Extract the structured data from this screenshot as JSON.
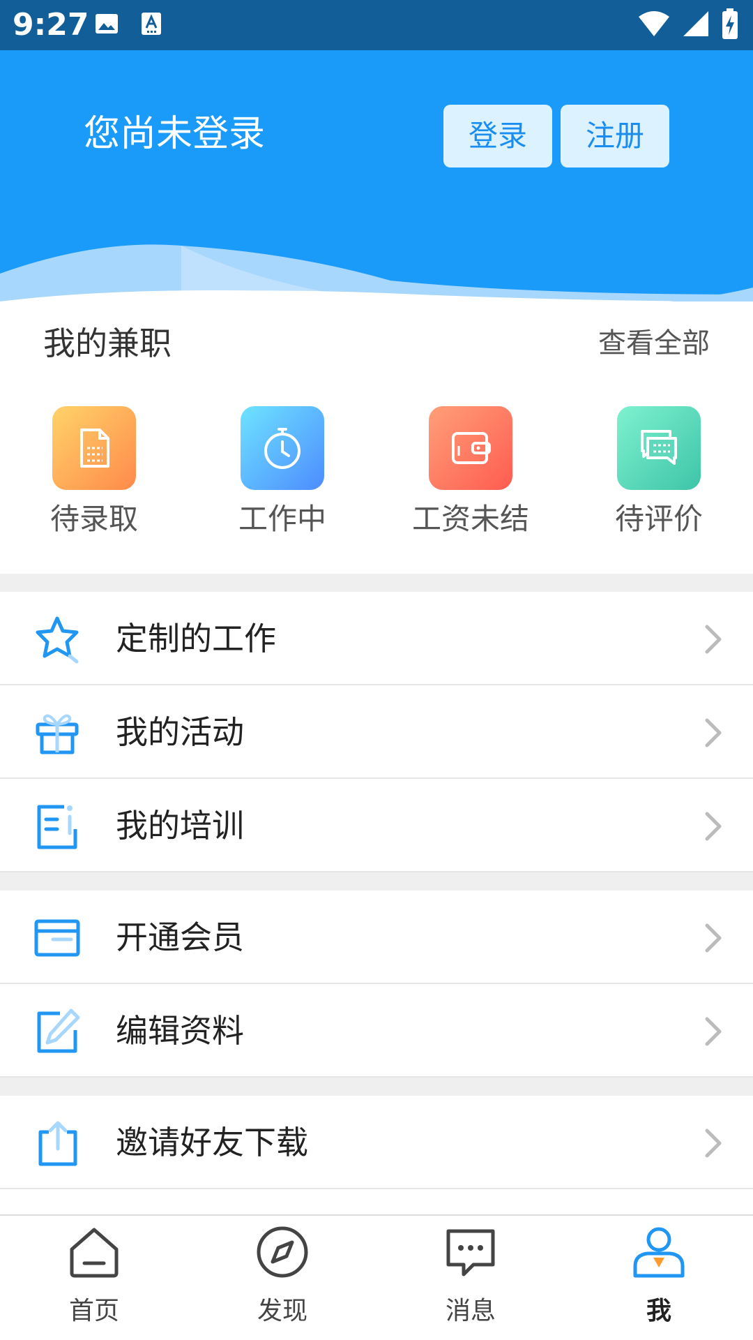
{
  "status_bar": {
    "time": "9:27"
  },
  "header": {
    "title": "您尚未登录",
    "login_label": "登录",
    "register_label": "注册"
  },
  "part_time": {
    "title": "我的兼职",
    "view_all": "查看全部",
    "items": [
      {
        "label": "待录取",
        "icon": "document-icon"
      },
      {
        "label": "工作中",
        "icon": "stopwatch-icon"
      },
      {
        "label": "工资未结",
        "icon": "wallet-icon"
      },
      {
        "label": "待评价",
        "icon": "chat-bubbles-icon"
      }
    ]
  },
  "menu": {
    "group1": [
      {
        "label": "定制的工作",
        "icon": "star-icon"
      },
      {
        "label": "我的活动",
        "icon": "gift-icon"
      },
      {
        "label": "我的培训",
        "icon": "training-icon"
      }
    ],
    "group2": [
      {
        "label": "开通会员",
        "icon": "card-icon"
      },
      {
        "label": "编辑资料",
        "icon": "edit-icon"
      }
    ],
    "group3": [
      {
        "label": "邀请好友下载",
        "icon": "share-icon"
      }
    ]
  },
  "bottom_nav": {
    "items": [
      {
        "label": "首页",
        "icon": "home-icon"
      },
      {
        "label": "发现",
        "icon": "compass-icon"
      },
      {
        "label": "消息",
        "icon": "message-icon"
      },
      {
        "label": "我",
        "icon": "user-icon",
        "active": true
      }
    ]
  },
  "colors": {
    "status_bar": "#125e99",
    "header": "#1a9bfa",
    "accent": "#2196f3",
    "button_bg": "#ddf2ff"
  }
}
